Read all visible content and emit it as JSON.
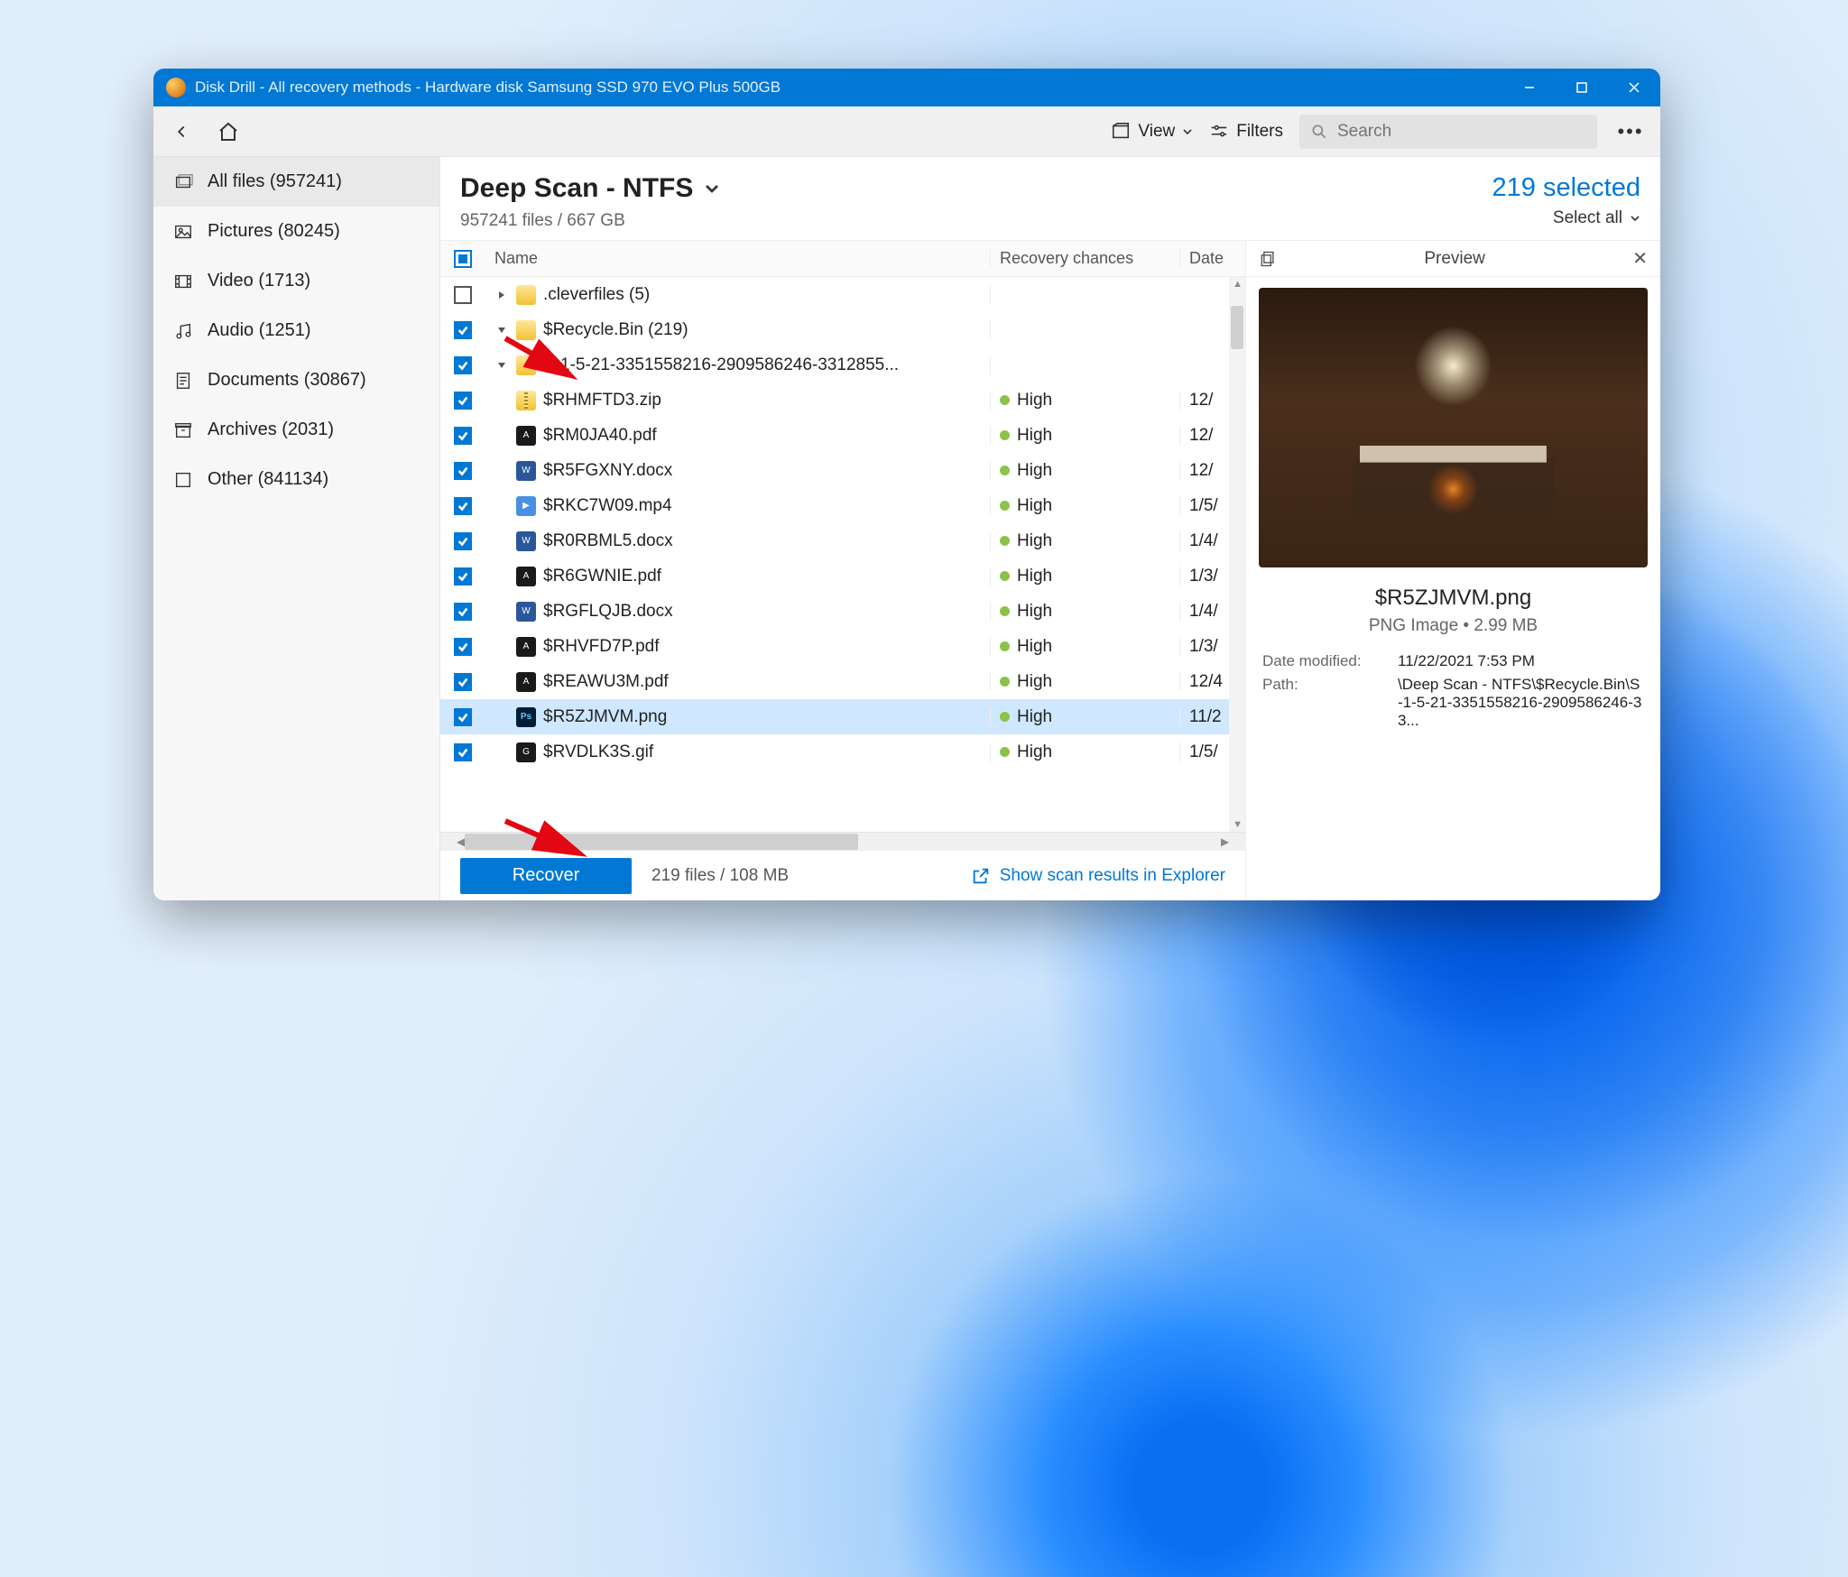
{
  "window": {
    "title": "Disk Drill - All recovery methods - Hardware disk Samsung SSD 970 EVO Plus 500GB"
  },
  "toolbar": {
    "view_label": "View",
    "filters_label": "Filters",
    "search_placeholder": "Search"
  },
  "sidebar": {
    "items": [
      {
        "label": "All files (957241)",
        "icon": "stack"
      },
      {
        "label": "Pictures (80245)",
        "icon": "image"
      },
      {
        "label": "Video (1713)",
        "icon": "film"
      },
      {
        "label": "Audio (1251)",
        "icon": "music"
      },
      {
        "label": "Documents (30867)",
        "icon": "doc"
      },
      {
        "label": "Archives (2031)",
        "icon": "archive"
      },
      {
        "label": "Other (841134)",
        "icon": "other"
      }
    ]
  },
  "main": {
    "title": "Deep Scan - NTFS",
    "subtitle": "957241 files / 667 GB",
    "selected_label": "219 selected",
    "select_all_label": "Select all"
  },
  "columns": {
    "name": "Name",
    "recovery": "Recovery chances",
    "date": "Date"
  },
  "rows": [
    {
      "check": "empty",
      "indent": 0,
      "disclosure": "right",
      "icon": "folder",
      "name": ".cleverfiles (5)",
      "recovery": "",
      "date": ""
    },
    {
      "check": "checked",
      "indent": 0,
      "disclosure": "down",
      "icon": "folder",
      "name": "$Recycle.Bin (219)",
      "recovery": "",
      "date": ""
    },
    {
      "check": "checked",
      "indent": 1,
      "disclosure": "down",
      "icon": "folder",
      "name": "S-1-5-21-3351558216-2909586246-3312855...",
      "recovery": "",
      "date": ""
    },
    {
      "check": "checked",
      "indent": 2,
      "disclosure": "",
      "icon": "zip",
      "name": "$RHMFTD3.zip",
      "recovery": "High",
      "date": "12/"
    },
    {
      "check": "checked",
      "indent": 2,
      "disclosure": "",
      "icon": "pdf",
      "name": "$RM0JA40.pdf",
      "recovery": "High",
      "date": "12/"
    },
    {
      "check": "checked",
      "indent": 2,
      "disclosure": "",
      "icon": "docx",
      "name": "$R5FGXNY.docx",
      "recovery": "High",
      "date": "12/"
    },
    {
      "check": "checked",
      "indent": 2,
      "disclosure": "",
      "icon": "mp4",
      "name": "$RKC7W09.mp4",
      "recovery": "High",
      "date": "1/5/"
    },
    {
      "check": "checked",
      "indent": 2,
      "disclosure": "",
      "icon": "docx",
      "name": "$R0RBML5.docx",
      "recovery": "High",
      "date": "1/4/"
    },
    {
      "check": "checked",
      "indent": 2,
      "disclosure": "",
      "icon": "pdf",
      "name": "$R6GWNIE.pdf",
      "recovery": "High",
      "date": "1/3/"
    },
    {
      "check": "checked",
      "indent": 2,
      "disclosure": "",
      "icon": "docx",
      "name": "$RGFLQJB.docx",
      "recovery": "High",
      "date": "1/4/"
    },
    {
      "check": "checked",
      "indent": 2,
      "disclosure": "",
      "icon": "pdf",
      "name": "$RHVFD7P.pdf",
      "recovery": "High",
      "date": "1/3/"
    },
    {
      "check": "checked",
      "indent": 2,
      "disclosure": "",
      "icon": "pdf",
      "name": "$REAWU3M.pdf",
      "recovery": "High",
      "date": "12/4"
    },
    {
      "check": "checked",
      "indent": 2,
      "disclosure": "",
      "icon": "ps",
      "name": "$R5ZJMVM.png",
      "recovery": "High",
      "date": "11/2",
      "selected": true
    },
    {
      "check": "checked",
      "indent": 2,
      "disclosure": "",
      "icon": "gif",
      "name": "$RVDLK3S.gif",
      "recovery": "High",
      "date": "1/5/"
    }
  ],
  "footer": {
    "recover_label": "Recover",
    "summary": "219 files / 108 MB",
    "show_link": "Show scan results in Explorer"
  },
  "preview": {
    "title": "Preview",
    "filename": "$R5ZJMVM.png",
    "meta": "PNG Image • 2.99 MB",
    "props": [
      {
        "label": "Date modified:",
        "value": "11/22/2021 7:53 PM"
      },
      {
        "label": "Path:",
        "value": "\\Deep Scan - NTFS\\$Recycle.Bin\\S-1-5-21-3351558216-2909586246-33..."
      }
    ]
  }
}
